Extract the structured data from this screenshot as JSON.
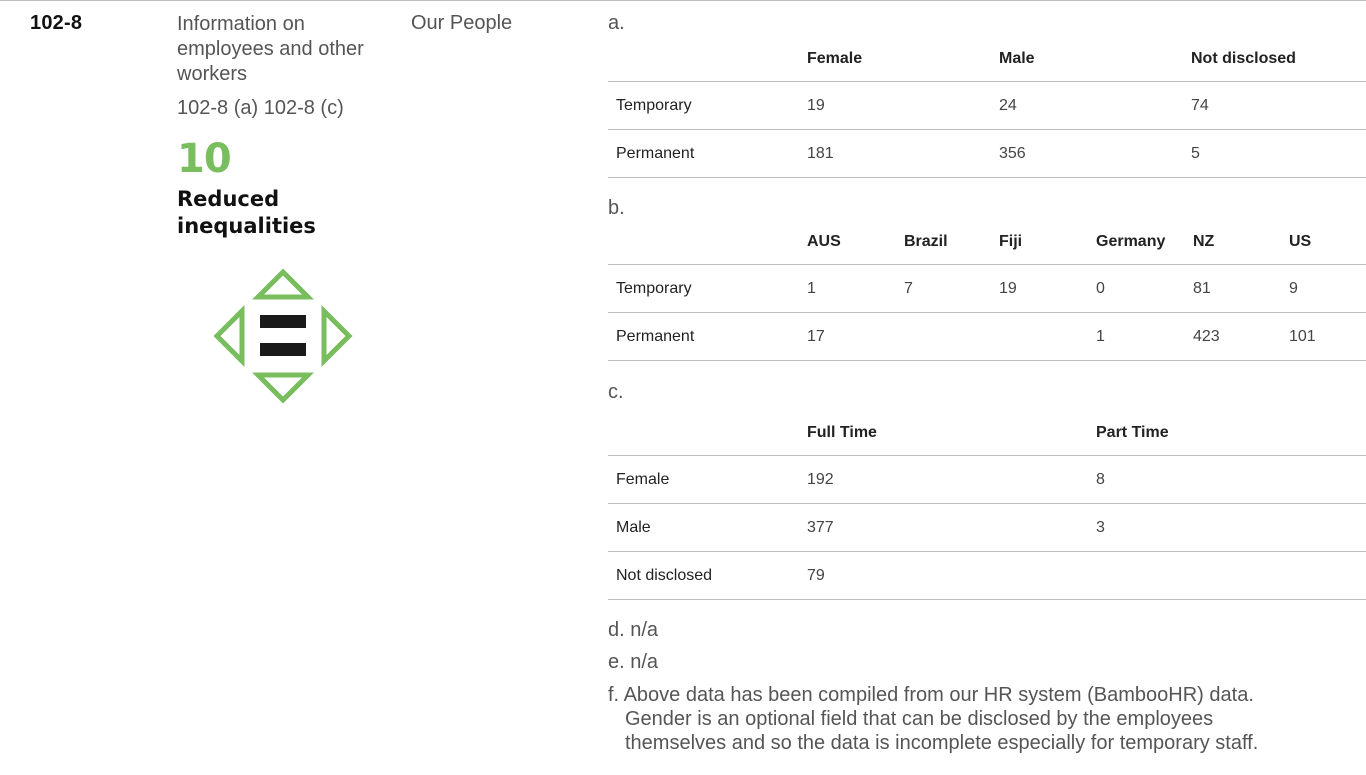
{
  "indicator": {
    "code": "102-8",
    "title": "Information on employees and other workers",
    "refs": "102-8 (a) 102-8 (c)",
    "location": "Our People"
  },
  "sdg": {
    "number": "10",
    "title": "Reduced inequalities",
    "icon": "reduced-inequalities-icon",
    "color": "#78bd5e"
  },
  "section_a": {
    "label": "a.",
    "headers": [
      "",
      "Female",
      "Male",
      "Not disclosed"
    ],
    "rows": [
      {
        "label": "Temporary",
        "values": [
          "19",
          "24",
          "74"
        ]
      },
      {
        "label": "Permanent",
        "values": [
          "181",
          "356",
          "5"
        ]
      }
    ]
  },
  "section_b": {
    "label": "b.",
    "headers": [
      "",
      "AUS",
      "Brazil",
      "Fiji",
      "Germany",
      "NZ",
      "US"
    ],
    "rows": [
      {
        "label": "Temporary",
        "values": [
          "1",
          "7",
          "19",
          "0",
          "81",
          "9"
        ]
      },
      {
        "label": "Permanent",
        "values": [
          "17",
          "",
          "",
          "1",
          "423",
          "101"
        ]
      }
    ]
  },
  "section_c": {
    "label": "c.",
    "headers": [
      "",
      "Full Time",
      "Part Time"
    ],
    "rows": [
      {
        "label": "Female",
        "values": [
          "192",
          "8"
        ]
      },
      {
        "label": "Male",
        "values": [
          "377",
          "3"
        ]
      },
      {
        "label": "Not disclosed",
        "values": [
          "79",
          ""
        ]
      }
    ]
  },
  "notes": {
    "d": "d. n/a",
    "e": "e. n/a",
    "f_prefix": "f.",
    "f_line1": "Above data has been compiled from our HR system (BambooHR) data.",
    "f_line2": "Gender is an optional field that can be disclosed by the employees",
    "f_line3": "themselves and so the data is incomplete especially for temporary staff."
  }
}
